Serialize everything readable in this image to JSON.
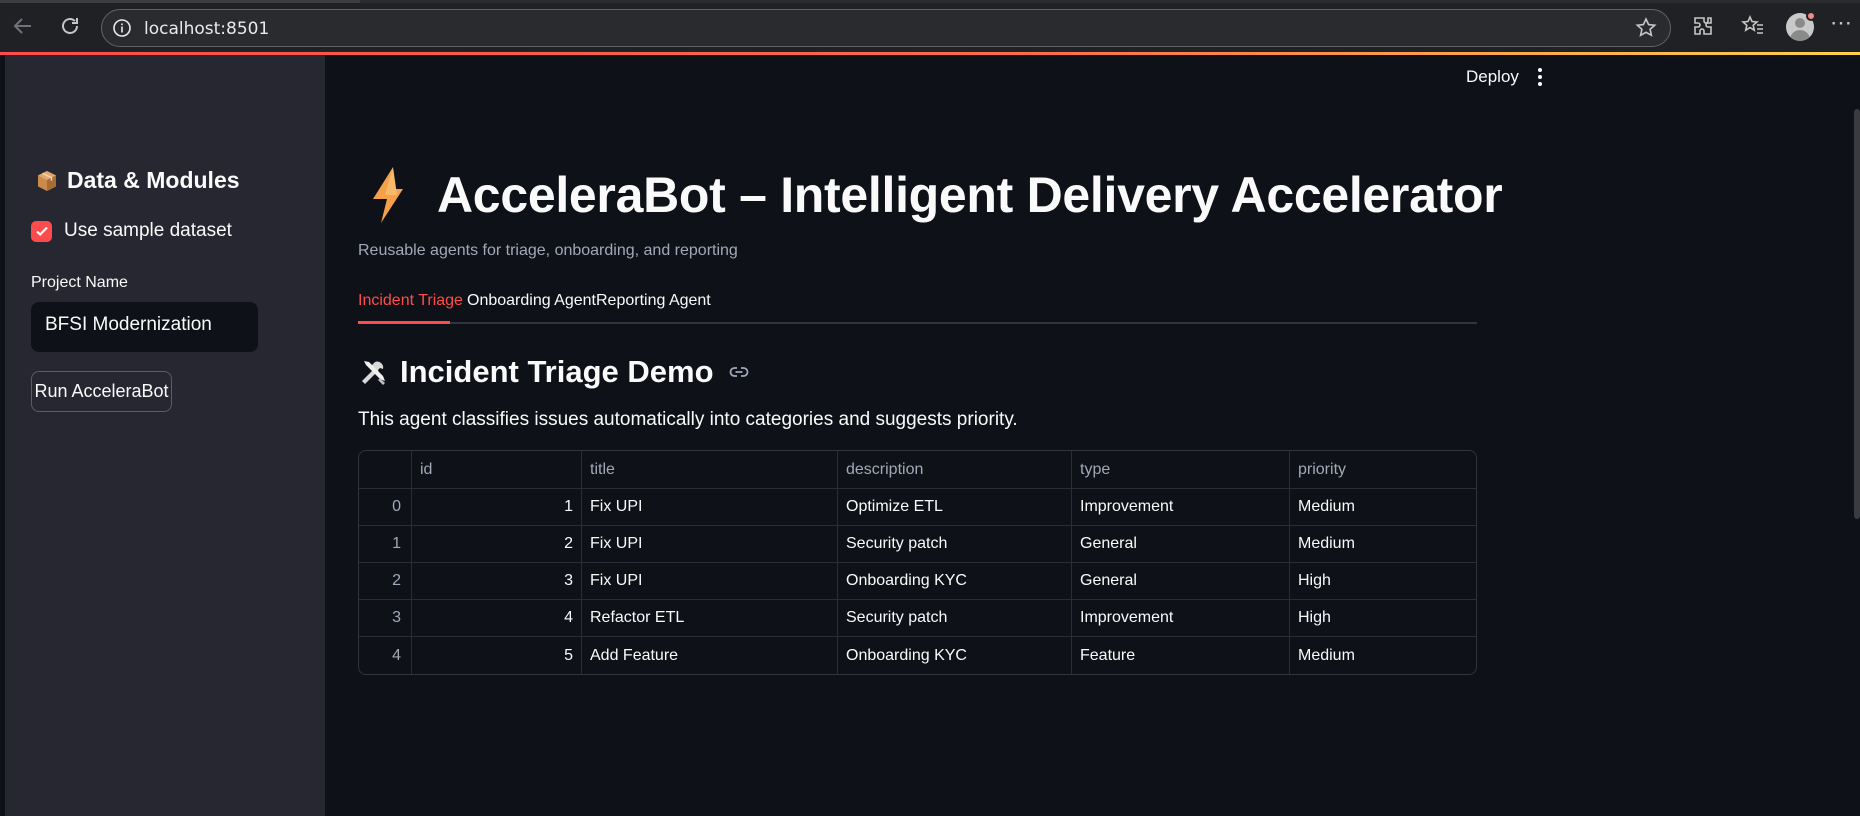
{
  "browser": {
    "url": "localhost:8501"
  },
  "sidebar": {
    "header": "Data & Modules",
    "checkbox_label": "Use sample dataset",
    "checkbox_checked": true,
    "project_label": "Project Name",
    "project_value": "BFSI Modernization",
    "run_button": "Run AcceleraBot"
  },
  "header": {
    "deploy": "Deploy"
  },
  "main": {
    "title": "AcceleraBot – Intelligent Delivery Accelerator",
    "caption": "Reusable agents for triage, onboarding, and reporting",
    "tabs": [
      {
        "label": "Incident Triage",
        "active": true
      },
      {
        "label": "Onboarding Agent",
        "active": false
      },
      {
        "label": "Reporting Agent",
        "active": false
      }
    ],
    "section_title": "Incident Triage Demo",
    "description": "This agent classifies issues automatically into categories and suggests priority."
  },
  "table": {
    "columns": [
      "",
      "id",
      "title",
      "description",
      "type",
      "priority"
    ],
    "rows": [
      [
        "0",
        "1",
        "Fix UPI",
        "Optimize ETL",
        "Improvement",
        "Medium"
      ],
      [
        "1",
        "2",
        "Fix UPI",
        "Security patch",
        "General",
        "Medium"
      ],
      [
        "2",
        "3",
        "Fix UPI",
        "Onboarding KYC",
        "General",
        "High"
      ],
      [
        "3",
        "4",
        "Refactor ETL",
        "Security patch",
        "Improvement",
        "High"
      ],
      [
        "4",
        "5",
        "Add Feature",
        "Onboarding KYC",
        "Feature",
        "Medium"
      ]
    ]
  },
  "colors": {
    "accent": "#ff4b4b",
    "background": "#0e1117",
    "sidebar": "#262730"
  }
}
